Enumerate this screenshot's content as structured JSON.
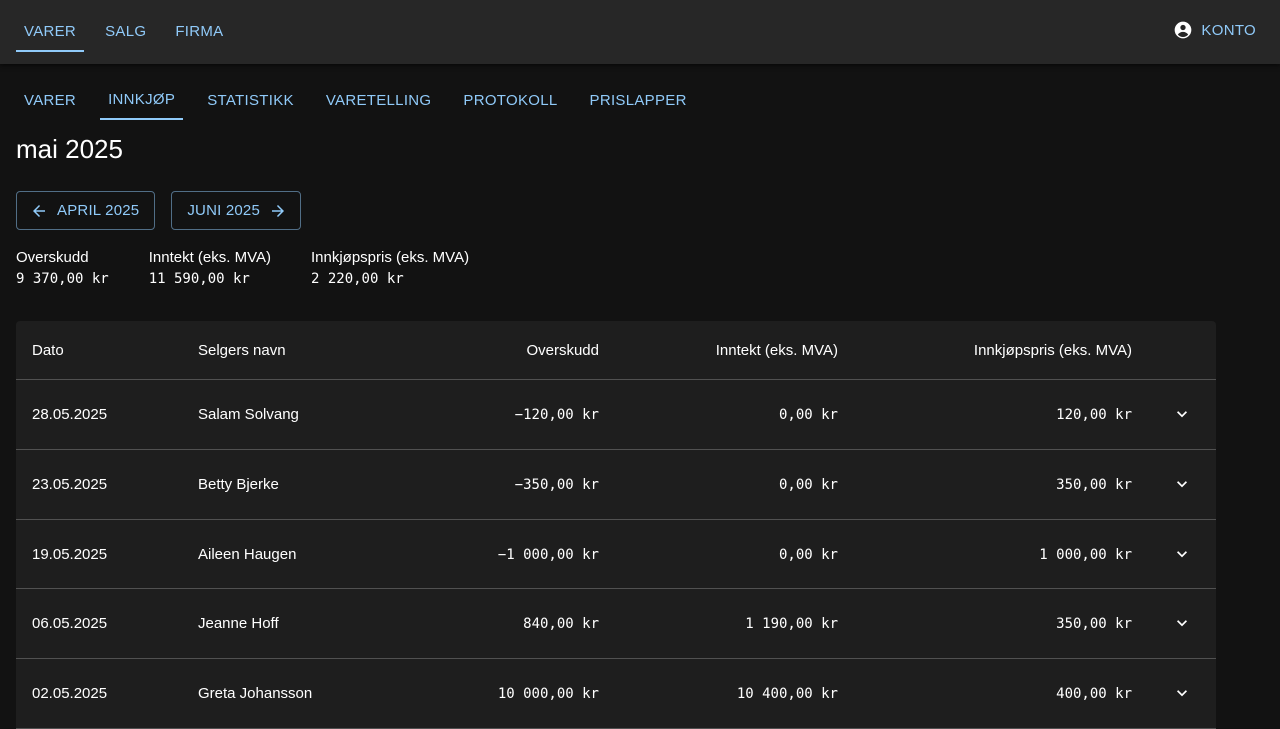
{
  "topnav": {
    "items": [
      {
        "label": "VARER",
        "active": true
      },
      {
        "label": "SALG",
        "active": false
      },
      {
        "label": "FIRMA",
        "active": false
      }
    ],
    "account_label": "KONTO",
    "account_icon": "account-circle-icon"
  },
  "subtabs": [
    {
      "label": "VARER",
      "active": false
    },
    {
      "label": "INNKJØP",
      "active": true
    },
    {
      "label": "STATISTIKK",
      "active": false
    },
    {
      "label": "VARETELLING",
      "active": false
    },
    {
      "label": "PROTOKOLL",
      "active": false
    },
    {
      "label": "PRISLAPPER",
      "active": false
    }
  ],
  "month_title": "mai 2025",
  "nav": {
    "prev_label": "APRIL 2025",
    "next_label": "JUNI 2025"
  },
  "summary": [
    {
      "label": "Overskudd",
      "value": "9 370,00 kr"
    },
    {
      "label": "Inntekt (eks. MVA)",
      "value": "11 590,00 kr"
    },
    {
      "label": "Innkjøpspris (eks. MVA)",
      "value": "2 220,00 kr"
    }
  ],
  "table": {
    "headers": {
      "date": "Dato",
      "seller": "Selgers navn",
      "surplus": "Overskudd",
      "income": "Inntekt (eks. MVA)",
      "purchase": "Innkjøpspris (eks. MVA)"
    },
    "rows": [
      {
        "date": "28.05.2025",
        "seller": "Salam Solvang",
        "surplus": "−120,00 kr",
        "income": "0,00 kr",
        "purchase": "120,00 kr"
      },
      {
        "date": "23.05.2025",
        "seller": "Betty Bjerke",
        "surplus": "−350,00 kr",
        "income": "0,00 kr",
        "purchase": "350,00 kr"
      },
      {
        "date": "19.05.2025",
        "seller": "Aileen Haugen",
        "surplus": "−1 000,00 kr",
        "income": "0,00 kr",
        "purchase": "1 000,00 kr"
      },
      {
        "date": "06.05.2025",
        "seller": "Jeanne Hoff",
        "surplus": "840,00 kr",
        "income": "1 190,00 kr",
        "purchase": "350,00 kr"
      },
      {
        "date": "02.05.2025",
        "seller": "Greta Johansson",
        "surplus": "10 000,00 kr",
        "income": "10 400,00 kr",
        "purchase": "400,00 kr"
      }
    ]
  },
  "colors": {
    "accent": "#90caf9",
    "appbar": "#272727",
    "background": "#121212",
    "surface": "#1e1e1e"
  }
}
